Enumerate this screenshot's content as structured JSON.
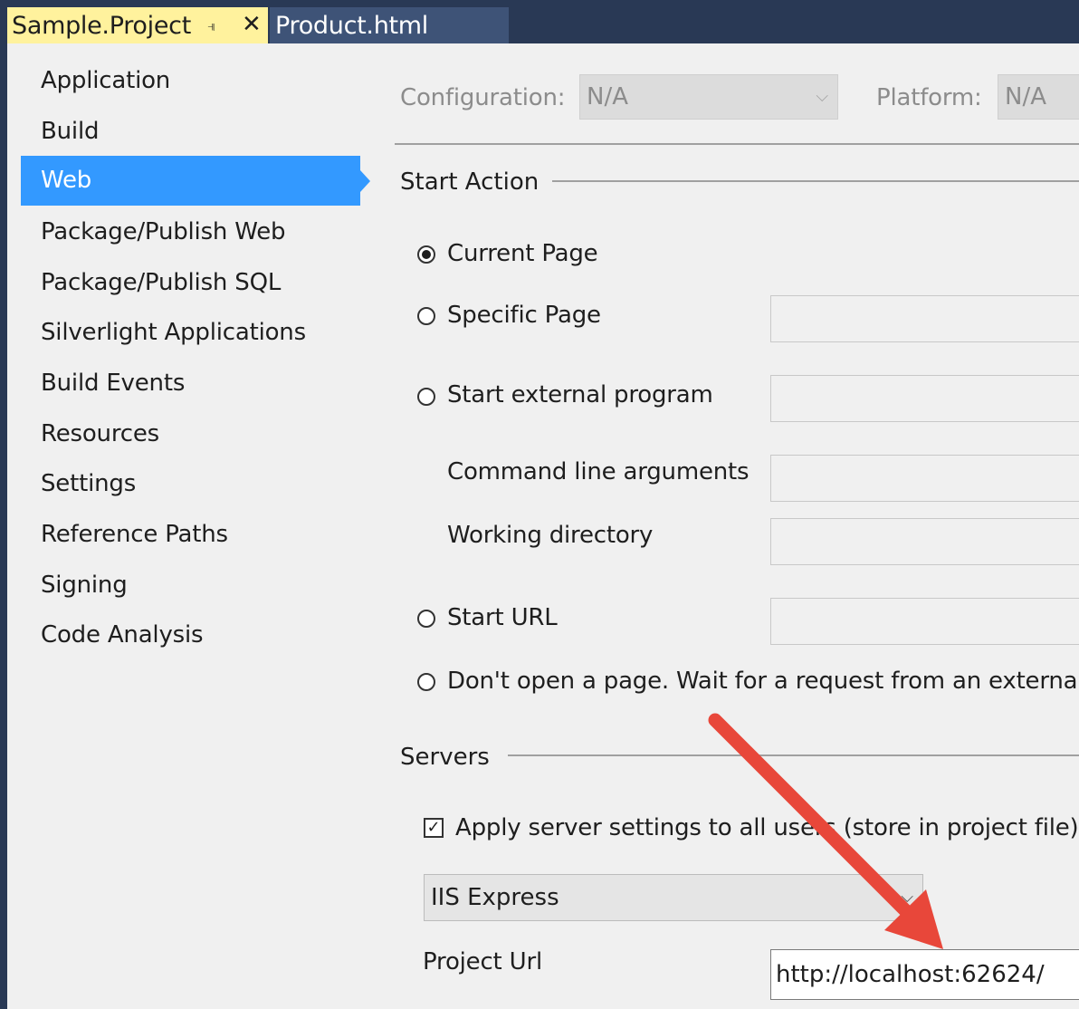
{
  "tabs": [
    {
      "title": "Sample.Project",
      "pin_icon": "pin-icon",
      "close_icon": "close-icon",
      "active": true
    },
    {
      "title": "Product.html",
      "active": false
    }
  ],
  "sidebar": {
    "items": [
      {
        "label": "Application"
      },
      {
        "label": "Build"
      },
      {
        "label": "Web",
        "active": true
      },
      {
        "label": "Package/Publish Web"
      },
      {
        "label": "Package/Publish SQL"
      },
      {
        "label": "Silverlight Applications"
      },
      {
        "label": "Build Events"
      },
      {
        "label": "Resources"
      },
      {
        "label": "Settings"
      },
      {
        "label": "Reference Paths"
      },
      {
        "label": "Signing"
      },
      {
        "label": "Code Analysis"
      }
    ]
  },
  "config": {
    "configuration_label": "Configuration:",
    "configuration_value": "N/A",
    "platform_label": "Platform:",
    "platform_value": "N/A"
  },
  "start_action": {
    "heading": "Start Action",
    "current_page": "Current Page",
    "specific_page": "Specific Page",
    "start_external_program": "Start external program",
    "command_line_arguments": "Command line arguments",
    "working_directory": "Working directory",
    "start_url": "Start URL",
    "dont_open": "Don't open a page.  Wait for a request from an external",
    "selected": "current_page"
  },
  "servers": {
    "heading": "Servers",
    "apply_settings_label": "Apply server settings to all users (store in project file)",
    "apply_settings_checked": true,
    "server_selected": "IIS Express",
    "project_url_label": "Project Url",
    "project_url_value": "http://localhost:62624/"
  },
  "colors": {
    "tabbar": "#293955",
    "active_tab": "#fff29d",
    "nav_active": "#3399ff",
    "annotation_arrow": "#e8473a"
  }
}
